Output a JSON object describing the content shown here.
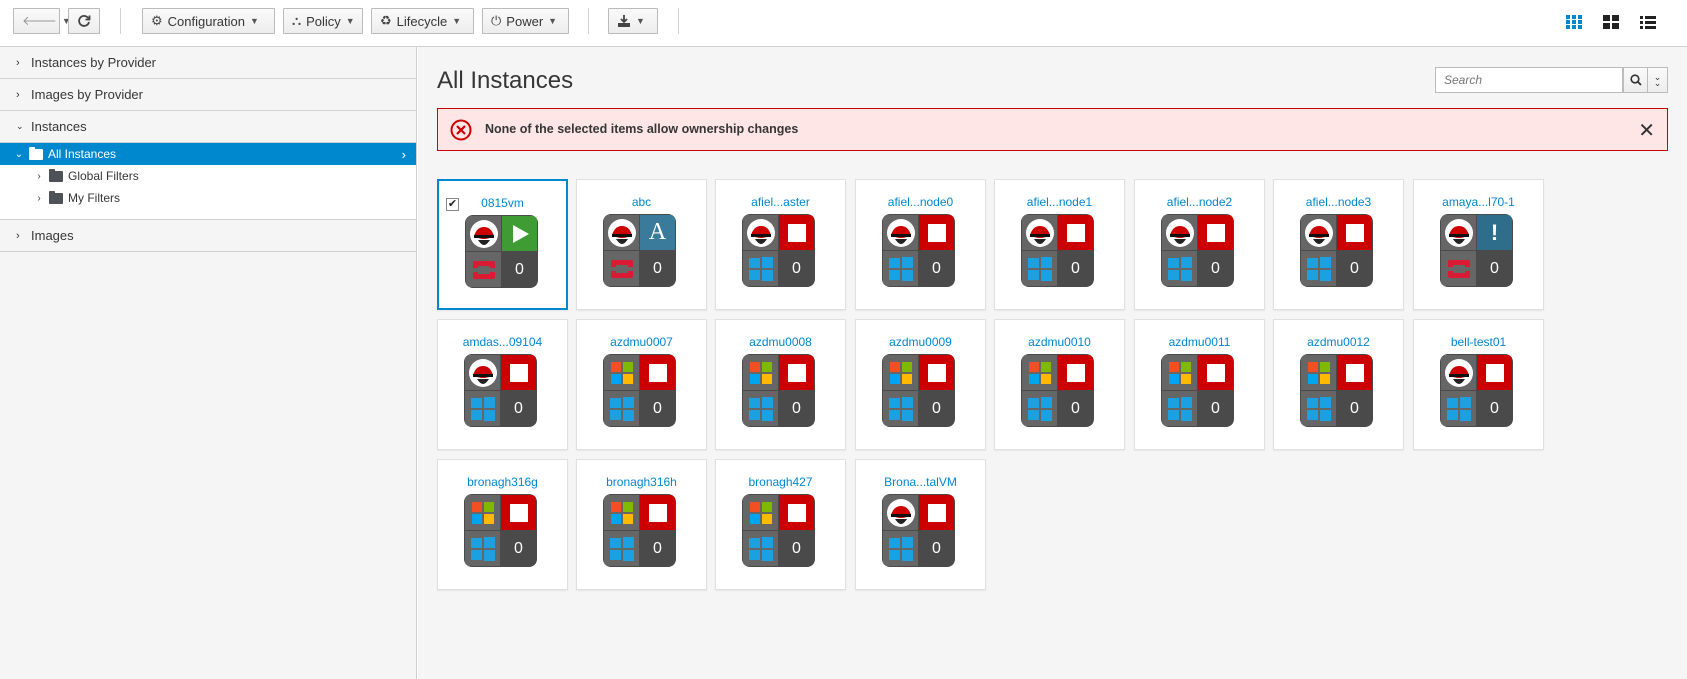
{
  "toolbar": {
    "back_icon": "arrow-left-icon",
    "refresh_icon": "refresh-icon",
    "configuration": "Configuration",
    "policy": "Policy",
    "lifecycle": "Lifecycle",
    "power": "Power",
    "download_icon": "download-icon",
    "views": [
      "grid-view",
      "tile-view",
      "list-view"
    ]
  },
  "sidebar": {
    "accordions": [
      {
        "label": "Instances by Provider",
        "expanded": false
      },
      {
        "label": "Images by Provider",
        "expanded": false
      },
      {
        "label": "Instances",
        "expanded": true
      },
      {
        "label": "Images",
        "expanded": false
      }
    ],
    "tree": {
      "root": "All Instances",
      "children": [
        "Global Filters",
        "My Filters"
      ]
    }
  },
  "main": {
    "title": "All Instances",
    "search_placeholder": "Search",
    "alert": "None of the selected items allow ownership changes",
    "tiles": [
      {
        "name": "0815vm",
        "os": "redhat",
        "state": "on",
        "vendor": "openstack",
        "count": "0",
        "selected": true
      },
      {
        "name": "abc",
        "os": "redhat",
        "state": "archived",
        "vendor": "openstack",
        "count": "0"
      },
      {
        "name": "afiel...aster",
        "os": "redhat",
        "state": "off",
        "vendor": "windows",
        "count": "0"
      },
      {
        "name": "afiel...node0",
        "os": "redhat",
        "state": "off",
        "vendor": "windows",
        "count": "0"
      },
      {
        "name": "afiel...node1",
        "os": "redhat",
        "state": "off",
        "vendor": "windows",
        "count": "0"
      },
      {
        "name": "afiel...node2",
        "os": "redhat",
        "state": "off",
        "vendor": "windows",
        "count": "0"
      },
      {
        "name": "afiel...node3",
        "os": "redhat",
        "state": "off",
        "vendor": "windows",
        "count": "0"
      },
      {
        "name": "amaya...l70-1",
        "os": "redhat",
        "state": "orphaned",
        "vendor": "openstack",
        "count": "0"
      },
      {
        "name": "amdas...09104",
        "os": "redhat",
        "state": "off",
        "vendor": "windows",
        "count": "0"
      },
      {
        "name": "azdmu0007",
        "os": "windows",
        "state": "off",
        "vendor": "windows",
        "count": "0"
      },
      {
        "name": "azdmu0008",
        "os": "windows",
        "state": "off",
        "vendor": "windows",
        "count": "0"
      },
      {
        "name": "azdmu0009",
        "os": "windows",
        "state": "off",
        "vendor": "windows",
        "count": "0"
      },
      {
        "name": "azdmu0010",
        "os": "windows",
        "state": "off",
        "vendor": "windows",
        "count": "0"
      },
      {
        "name": "azdmu0011",
        "os": "windows",
        "state": "off",
        "vendor": "windows",
        "count": "0"
      },
      {
        "name": "azdmu0012",
        "os": "windows",
        "state": "off",
        "vendor": "windows",
        "count": "0"
      },
      {
        "name": "bell-test01",
        "os": "redhat",
        "state": "off",
        "vendor": "windows",
        "count": "0"
      },
      {
        "name": "bronagh316g",
        "os": "windows",
        "state": "off",
        "vendor": "windows",
        "count": "0"
      },
      {
        "name": "bronagh316h",
        "os": "windows",
        "state": "off",
        "vendor": "windows",
        "count": "0"
      },
      {
        "name": "bronagh427",
        "os": "windows",
        "state": "off",
        "vendor": "windows",
        "count": "0"
      },
      {
        "name": "Brona...talVM",
        "os": "redhat",
        "state": "off",
        "vendor": "windows",
        "count": "0"
      }
    ]
  },
  "colors": {
    "accent": "#0088ce",
    "alert_bg": "#ffe6e6",
    "alert_border": "#cc0000",
    "state_off": "#cc0000",
    "state_on": "#3f9c35"
  }
}
